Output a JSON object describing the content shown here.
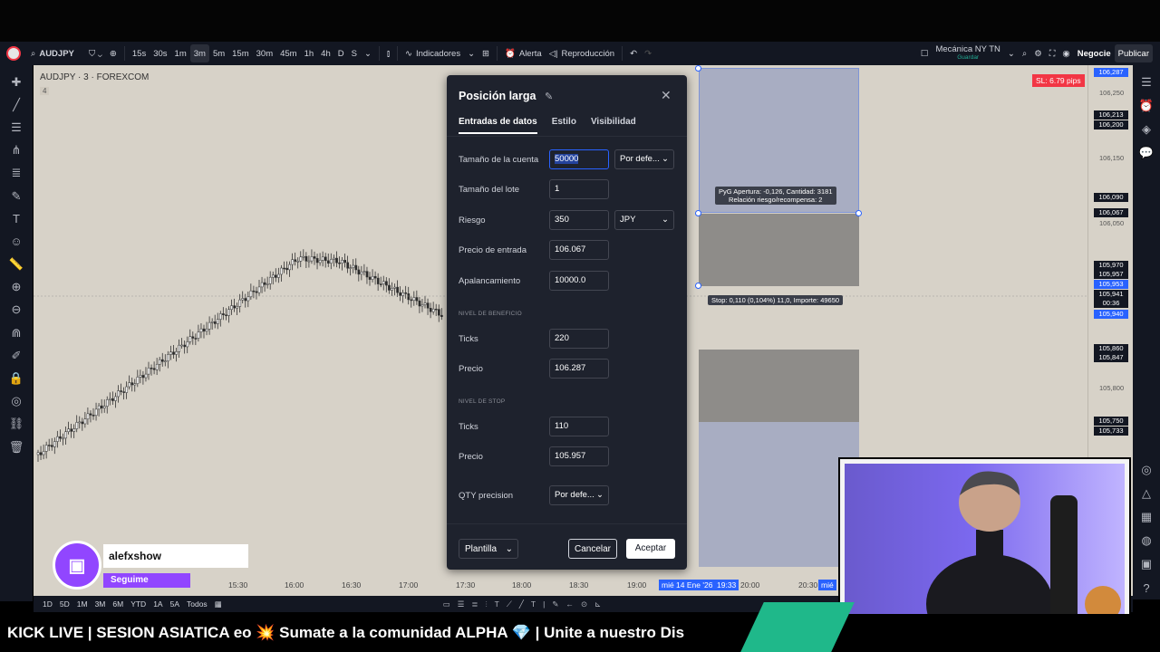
{
  "toolbar": {
    "symbol": "AUDJPY",
    "intervals": [
      "15s",
      "30s",
      "1m",
      "3m",
      "5m",
      "15m",
      "30m",
      "45m",
      "1h",
      "4h",
      "D",
      "S"
    ],
    "active_interval": "3m",
    "indicators": "Indicadores",
    "alert": "Alerta",
    "replay": "Reproducción",
    "layout_name": "Mecánica NY TN",
    "layout_saved": "Guardar",
    "trade": "Negocie",
    "publish": "Publicar"
  },
  "chart": {
    "symbol_line": "AUDJPY · 3 · FOREXCOM",
    "sub_line": "4",
    "sl_badge": "SL: 6.79 pips",
    "tooltip_top_line1": "PyG Apertura: -0,126, Cantidad: 3181",
    "tooltip_top_line2": "Relación riesgo/recompensa: 2",
    "tooltip_stop": "Stop: 0,110 (0,104%) 11,0, Importe: 49650",
    "price_labels": [
      "106,250",
      "106,150",
      "106,050",
      "105,800"
    ],
    "price_badges": [
      {
        "v": "106,287",
        "c": "#2962ff"
      },
      {
        "v": "106,213",
        "c": "#131722"
      },
      {
        "v": "106,200",
        "c": "#131722"
      },
      {
        "v": "106,090",
        "c": "#131722"
      },
      {
        "v": "106,067",
        "c": "#131722"
      },
      {
        "v": "105,970",
        "c": "#131722"
      },
      {
        "v": "105,957",
        "c": "#131722"
      },
      {
        "v": "105,953",
        "c": "#2962ff"
      },
      {
        "v": "105,941",
        "c": "#131722"
      },
      {
        "v": "00:36",
        "c": "#131722"
      },
      {
        "v": "105,940",
        "c": "#2962ff"
      },
      {
        "v": "105,860",
        "c": "#131722"
      },
      {
        "v": "105,847",
        "c": "#131722"
      },
      {
        "v": "105,750",
        "c": "#131722"
      },
      {
        "v": "105,733",
        "c": "#131722"
      }
    ],
    "time_labels": [
      "15:30",
      "16:00",
      "16:30",
      "17:00",
      "17:30",
      "18:00",
      "18:30",
      "19:00",
      "20:00",
      "20:30"
    ],
    "time_highlight": "mié 14 Ene '26",
    "time_highlight2": "19:33",
    "time_highlight3": "mié"
  },
  "bottom": {
    "ranges": [
      "1D",
      "5D",
      "1M",
      "3M",
      "6M",
      "YTD",
      "1A",
      "5A",
      "Todos"
    ]
  },
  "dialog": {
    "title": "Posición larga",
    "tabs": [
      "Entradas de datos",
      "Estilo",
      "Visibilidad"
    ],
    "account_size_label": "Tamaño de la cuenta",
    "account_size": "50000",
    "account_mode": "Por defe...",
    "lot_size_label": "Tamaño del lote",
    "lot_size": "1",
    "risk_label": "Riesgo",
    "risk": "350",
    "risk_currency": "JPY",
    "entry_label": "Precio de entrada",
    "entry": "106.067",
    "leverage_label": "Apalancamiento",
    "leverage": "10000.0",
    "profit_section": "NIVEL DE BENEFICIO",
    "profit_ticks_label": "Ticks",
    "profit_ticks": "220",
    "profit_price_label": "Precio",
    "profit_price": "106.287",
    "stop_section": "NIVEL DE STOP",
    "stop_ticks_label": "Ticks",
    "stop_ticks": "110",
    "stop_price_label": "Precio",
    "stop_price": "105.957",
    "qty_label": "QTY precision",
    "qty_mode": "Por defe...",
    "template": "Plantilla",
    "cancel": "Cancelar",
    "accept": "Aceptar"
  },
  "overlay": {
    "twitch_name": "alefxshow",
    "twitch_follow": "Seguime",
    "ticker_text": "KICK LIVE | SESION ASIATICA eo 💥 Sumate a la comunidad ALPHA 💎 | Unite a nuestro  Dis"
  },
  "colors": {
    "accent": "#2962ff",
    "stop": "#f23645",
    "panel": "#131722",
    "dialog": "#1e222d"
  }
}
